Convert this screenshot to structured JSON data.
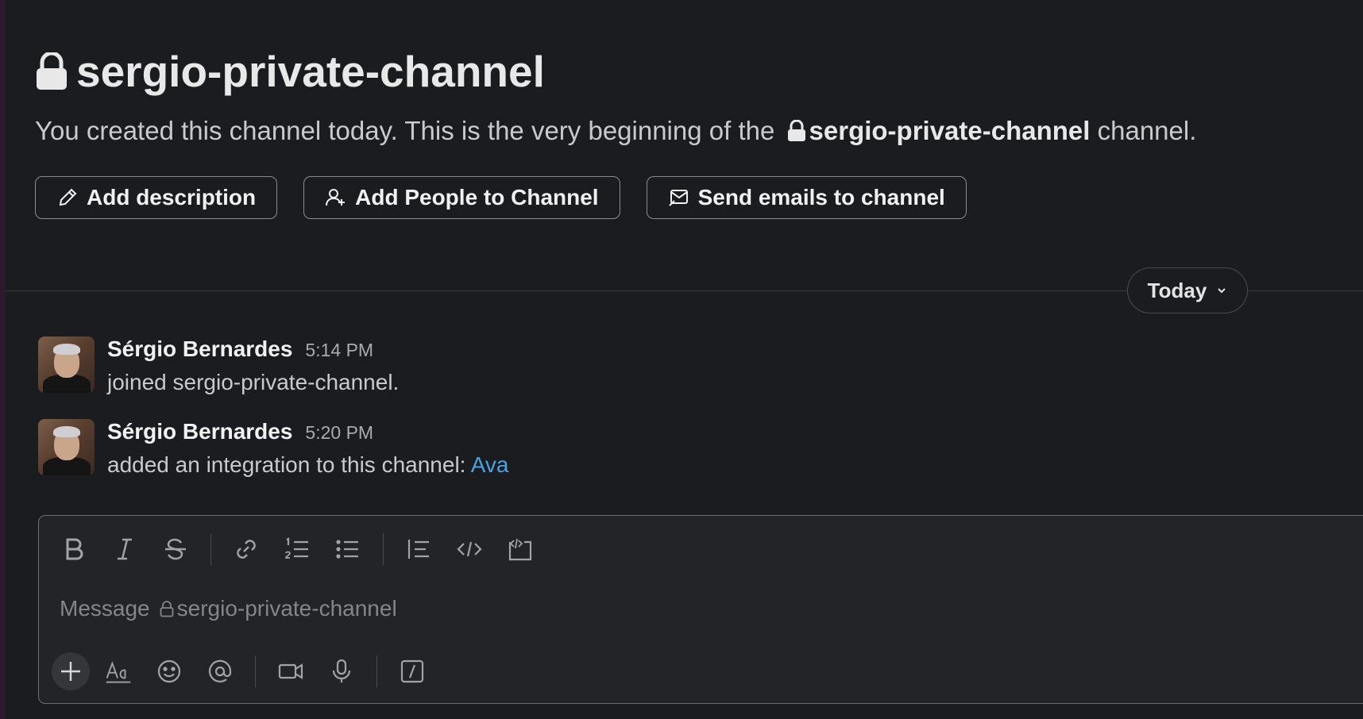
{
  "channel": {
    "name": "sergio-private-channel",
    "intro_prefix": "You created this channel today. This is the very beginning of the",
    "intro_suffix": "channel."
  },
  "actions": {
    "add_description": "Add description",
    "add_people": "Add People to Channel",
    "send_emails": "Send emails to channel"
  },
  "date_divider": {
    "label": "Today"
  },
  "messages": [
    {
      "author": "Sérgio Bernardes",
      "time": "5:14 PM",
      "text": "joined sergio-private-channel."
    },
    {
      "author": "Sérgio Bernardes",
      "time": "5:20 PM",
      "text": "added an integration to this channel:",
      "link": "Ava"
    }
  ],
  "composer": {
    "placeholder_prefix": "Message",
    "placeholder_channel": "sergio-private-channel",
    "toolbar_icons": [
      "bold-icon",
      "italic-icon",
      "strikethrough-icon",
      "link-icon",
      "ordered-list-icon",
      "bulleted-list-icon",
      "blockquote-icon",
      "code-icon",
      "code-block-icon"
    ],
    "bottom_icons": [
      "plus-icon",
      "formatting-icon",
      "emoji-icon",
      "mention-icon",
      "video-icon",
      "microphone-icon",
      "slash-command-icon"
    ]
  },
  "colors": {
    "background": "#1b1c20",
    "link": "#4aa3df",
    "composer_bg": "#222428"
  }
}
